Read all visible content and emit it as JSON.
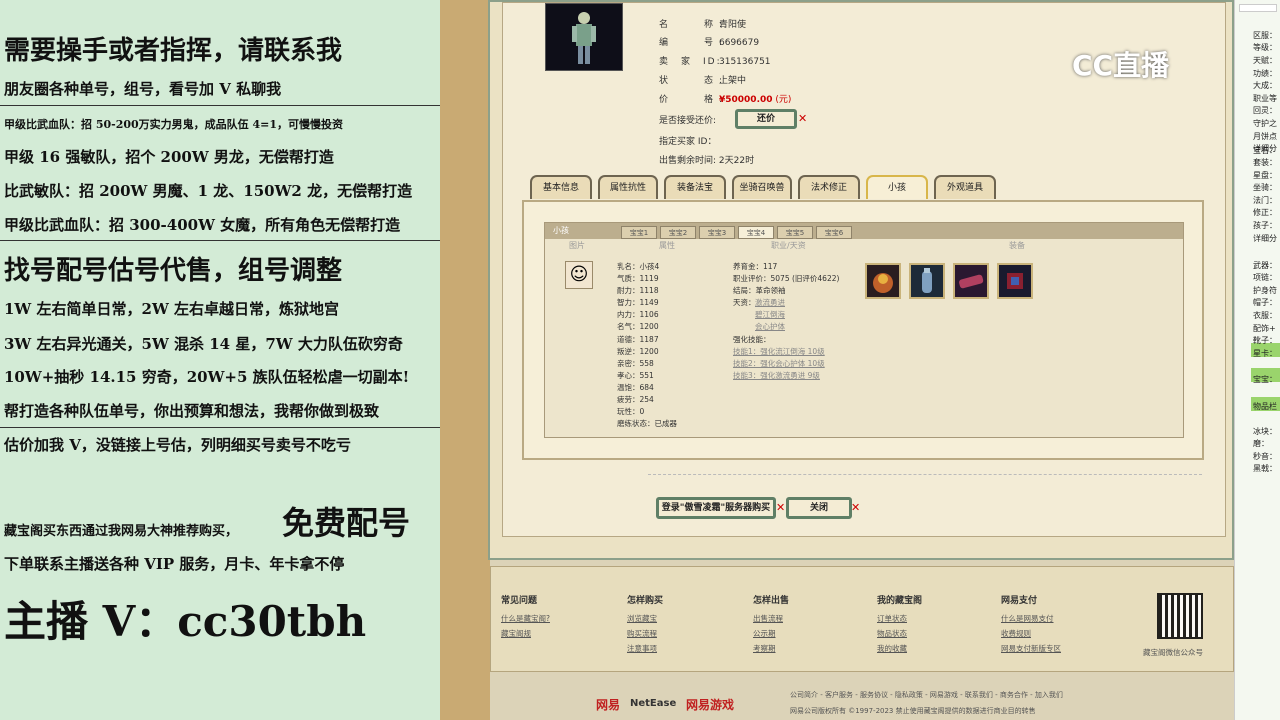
{
  "overlay": {
    "l1": "需要操手或者指挥，请联系我",
    "l2": "朋友圈各种单号，组号，看号加 V 私聊我",
    "l3": "甲级比武血队：招 50-200万实力男鬼，成品队伍 4=1，可慢慢投资",
    "l4": "甲级 16 强敏队，招个 200W 男龙，无偿帮打造",
    "l5": "比武敏队：招 200W 男魔、1 龙、150W2 龙，无偿帮打造",
    "l6": "甲级比武血队：招 300-400W 女魔，所有角色无偿帮打造",
    "l7": "找号配号估号代售，组号调整",
    "l8": "1W 左右简单日常，2W 左右卓越日常，炼狱地宫",
    "l9": "3W 左右异光通关，5W 混杀 14 星，7W 大力队伍砍穷奇",
    "l10": "10W+抽秒 14.15 穷奇，20W+5 族队伍轻松虐一切副本!",
    "l11": "帮打造各种队伍单号，你出预算和想法，我帮你做到极致",
    "l12": "估价加我 V，没链接上号估，列明细买号卖号不吃亏",
    "l13a": "藏宝阁买东西通过我网易大神推荐购买，",
    "l13b": "免费配号",
    "l14": "下单联系主播送各种 VIP 服务，月卡、年卡拿不停",
    "l15": "主播 V：cc30tbh"
  },
  "item": {
    "name_label": "名　　称:",
    "name": "青阳使",
    "id_label": "编　　号:",
    "id": "6696679",
    "seller_label": "卖　家　ID:",
    "seller": "315136751",
    "status_label": "状　　态:",
    "status": "上架中",
    "price_label": "价　　格:",
    "price": "¥50000.00",
    "price_unit": "(元)",
    "bargain_label": "是否接受还价:",
    "bargain_btn": "还价",
    "buyer_label": "指定买家 ID：",
    "remain_label": "出售剩余时间:",
    "remain": "2天22时"
  },
  "tabs": [
    "基本信息",
    "属性抗性",
    "装备法宝",
    "坐骑召唤兽",
    "法术修正",
    "小孩",
    "外观道具"
  ],
  "sub": {
    "title": "小孩",
    "tabs": [
      "宝宝1",
      "宝宝2",
      "宝宝3",
      "宝宝4",
      "宝宝5",
      "宝宝6"
    ],
    "col_avatar": "图片",
    "col_attr": "属性",
    "col_skill": "职业/天资",
    "col_equip": "装备",
    "stats": [
      "乳名：小孩4",
      "气质：1119",
      "耐力：1118",
      "智力：1149",
      "内力：1106",
      "名气：1200",
      "道德：1187",
      "叛逆：1200",
      "亲密：558",
      "孝心：551",
      "温饱：684",
      "疲劳：254",
      "玩性：0",
      "磨练状态：已成器"
    ],
    "right": {
      "money": "养育金：117",
      "score": "职业评价：5075 (旧评价4622)",
      "ending": "结局：革命领袖",
      "tz_label": "天资：",
      "tz": [
        "激流勇进",
        "碧江倒海",
        "会心护体"
      ],
      "skill_label": "强化技能：",
      "skills": [
        "技能1：强化流江倒海 10级",
        "技能2：强化会心护体 10级",
        "技能3：强化激流勇进 9级"
      ]
    }
  },
  "buttons": {
    "login": "登录\"傲雪凌霜\"服务器购买",
    "close": "关闭"
  },
  "footer": {
    "cols": [
      {
        "h": "常见问题",
        "a": "什么是藏宝阁?",
        "b": "藏宝阁规"
      },
      {
        "h": "怎样购买",
        "a": "浏览藏宝",
        "b": "购买流程",
        "c": "注意事项"
      },
      {
        "h": "怎样出售",
        "a": "出售流程",
        "b": "公示期",
        "c": "考察期"
      },
      {
        "h": "我的藏宝阁",
        "a": "订单状态",
        "b": "物品状态",
        "c": "我的收藏"
      },
      {
        "h": "网易支付",
        "a": "什么是网易支付",
        "b": "收费规则",
        "c": "网易支付新版专区"
      }
    ],
    "qr_caption": "藏宝阁微信公众号"
  },
  "bottom": {
    "brand1": "网易",
    "brand2": "NetEase",
    "brand3": "网易游戏",
    "links": "公司简介 - 客户服务 - 服务协议 - 隐私政策 - 网易游戏 - 联系我们 - 商务合作 - 加入我们",
    "copyright": "网易公司版权所有 ©1997-2023 禁止使用藏宝阁提供的数据进行商业目的转售"
  },
  "logo": "CC直播",
  "right_labels": [
    "区服：",
    "等级：",
    "天赋：",
    "功绩：",
    "大成：",
    "职业等",
    "回灵：",
    "守护之",
    "月饼点",
    "详细分",
    "宝石：",
    "套装：",
    "星盘：",
    "坐骑：",
    "法门：",
    "修正：",
    "孩子：",
    "详细分",
    "武器：",
    "项链：",
    "护身符",
    "帽子：",
    "衣服：",
    "配饰+",
    "靴子：",
    "星卡：",
    "宝宝：",
    "物品栏",
    "冰块：",
    "磨：",
    "秒音：",
    "黑戟："
  ]
}
